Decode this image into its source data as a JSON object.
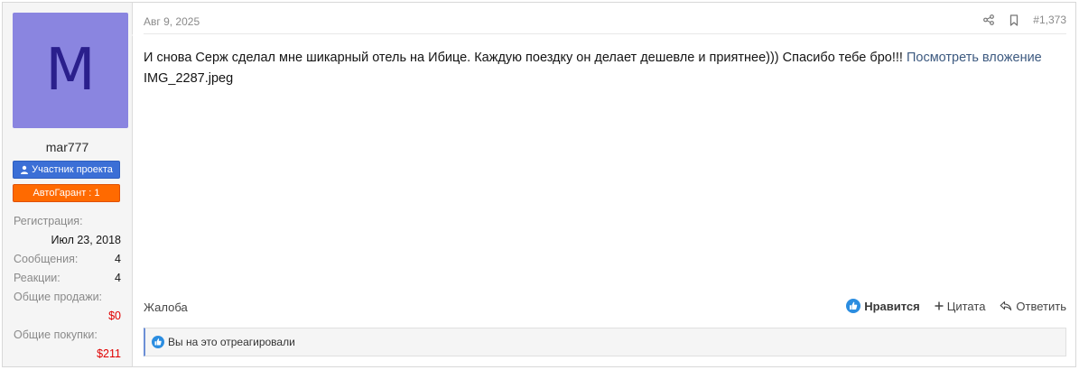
{
  "user": {
    "avatar_letter": "M",
    "avatar_color": "#8a85e0",
    "username": "mar777",
    "badge_member": "Участник проекта",
    "badge_member_color": "#3b6fd6",
    "badge_guarantee": "АвтоГарант : 1",
    "badge_guarantee_color": "#ff6a00",
    "stats": {
      "registration_label": "Регистрация:",
      "registration_value": "Июл 23, 2018",
      "messages_label": "Сообщения:",
      "messages_value": "4",
      "reactions_label": "Реакции:",
      "reactions_value": "4",
      "sales_label": "Общие продажи:",
      "sales_value": "$0",
      "purchases_label": "Общие покупки:",
      "purchases_value": "$211"
    }
  },
  "post": {
    "date": "Авг 9, 2025",
    "number": "#1,373",
    "share_icon": "share-icon",
    "bookmark_icon": "bookmark-icon",
    "text": "И снова Серж сделал мне шикарный отель на Ибице. Каждую поездку он делает дешевле и приятнее))) Спасибо тебе бро!!! ",
    "attachment_link": "Посмотреть вложение",
    "attachment_name": "IMG_2287.jpeg"
  },
  "footer": {
    "report": "Жалоба",
    "like": "Нравится",
    "quote": "Цитата",
    "reply": "Ответить",
    "like_color": "#2b8de0"
  },
  "reactions": {
    "text": "Вы на это отреагировали"
  }
}
